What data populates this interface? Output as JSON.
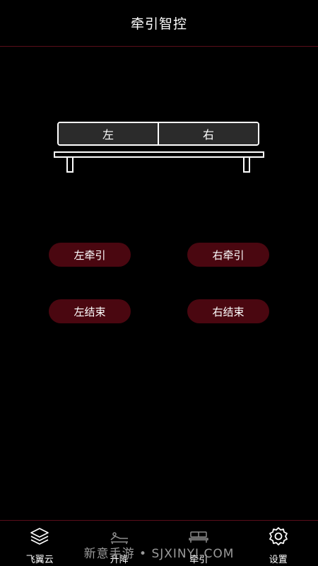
{
  "header": {
    "title": "牵引智控"
  },
  "bed": {
    "left_label": "左",
    "right_label": "右"
  },
  "controls": {
    "left_traction": "左牵引",
    "right_traction": "右牵引",
    "left_end": "左结束",
    "right_end": "右结束"
  },
  "nav": {
    "items": [
      {
        "label": "飞翼云",
        "icon": "layers-icon"
      },
      {
        "label": "升降",
        "icon": "bed-lift-icon"
      },
      {
        "label": "牵引",
        "icon": "bed-traction-icon"
      },
      {
        "label": "设置",
        "icon": "gear-icon"
      }
    ]
  },
  "watermark": "新意手游 • SJXINYI.COM",
  "colors": {
    "accent": "#4a0710",
    "divider": "#5a0d1a",
    "background": "#000000"
  }
}
